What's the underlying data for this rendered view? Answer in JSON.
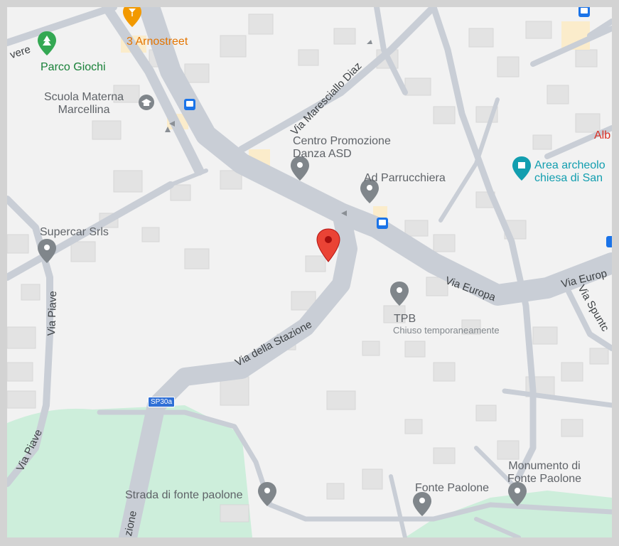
{
  "streets": {
    "via_piave_1": "Via Piave",
    "via_piave_2": "Via Piave",
    "via_maresciallo_diaz": "Via Maresciallo Diaz",
    "via_europa_1": "Via Europa",
    "via_europa_2": "Via Europ",
    "via_spuntone": "Via Spuntc",
    "via_della_stazione": "Via della Stazione",
    "stazione_fragment": "zione",
    "tevere_fragment": "vere",
    "road_shield": "SP30a"
  },
  "places": {
    "arnostreet": "3 Arnostreet",
    "parco_giochi": "Parco Giochi",
    "scuola_line1": "Scuola Materna",
    "scuola_line2": "Marcellina",
    "centro_line1": "Centro Promozione",
    "centro_line2": "Danza ASD",
    "parrucchiera": "Ad Parrucchiera",
    "supercar": "Supercar Srls",
    "tpb": "TPB",
    "tpb_status": "Chiuso temporaneamente",
    "area_line1": "Area archeolo",
    "area_line2": "chiesa di San",
    "alb": "Alb",
    "strada_fonte": "Strada di fonte paolone",
    "fonte_paolone": "Fonte Paolone",
    "monumento_line1": "Monumento di",
    "monumento_line2": "Fonte Paolone"
  },
  "colors": {
    "background": "#f2f2f2",
    "road": "#c6ccd4",
    "park": "#cdeedb",
    "building": "#e6e6e6",
    "pin_red": "#ea4335",
    "pin_gray": "#80868b",
    "pin_green": "#34a853",
    "pin_orange": "#f29900",
    "pin_teal": "#129eaf",
    "transit_blue": "#1a73e8"
  }
}
